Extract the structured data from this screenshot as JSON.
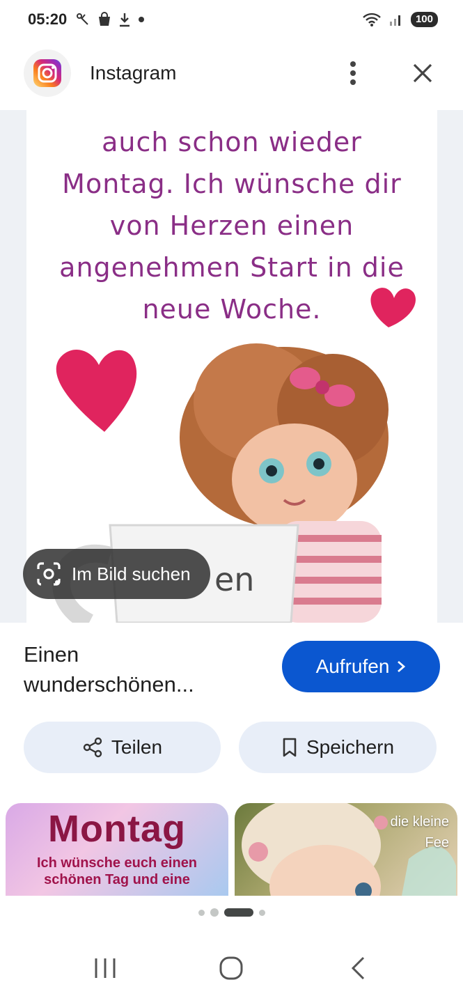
{
  "status_bar": {
    "time": "05:20",
    "notification_icons": [
      "scissors-share-icon",
      "bag-icon",
      "download-icon",
      "dot-icon"
    ],
    "battery": "100"
  },
  "app_header": {
    "app_name": "Instagram",
    "app_icon": "instagram-icon",
    "menu_icon": "more-vert-icon",
    "close_icon": "close-icon"
  },
  "image": {
    "poem_lines": [
      "auch schon wieder",
      "Montag. Ich wünsche dir",
      "von Herzen einen",
      "angenehmen Start in die",
      "neue Woche."
    ],
    "lens_button_label": "Im Bild suchen"
  },
  "result": {
    "title": "Einen wunderschönen...",
    "visit_label": "Aufrufen",
    "share_label": "Teilen",
    "save_label": "Speichern"
  },
  "related": [
    {
      "title": "Montag",
      "subtitle_lines": [
        "Ich wünsche euch einen",
        "schönen Tag und eine"
      ]
    },
    {
      "label_lines": [
        "die kleine",
        "Fee"
      ]
    }
  ],
  "pager": {
    "count": 4,
    "active_index": 2
  },
  "colors": {
    "accent": "#0b57d0",
    "chip_bg": "#e8eef8",
    "poem_text": "#8a2e86",
    "heart": "#e0245e"
  }
}
